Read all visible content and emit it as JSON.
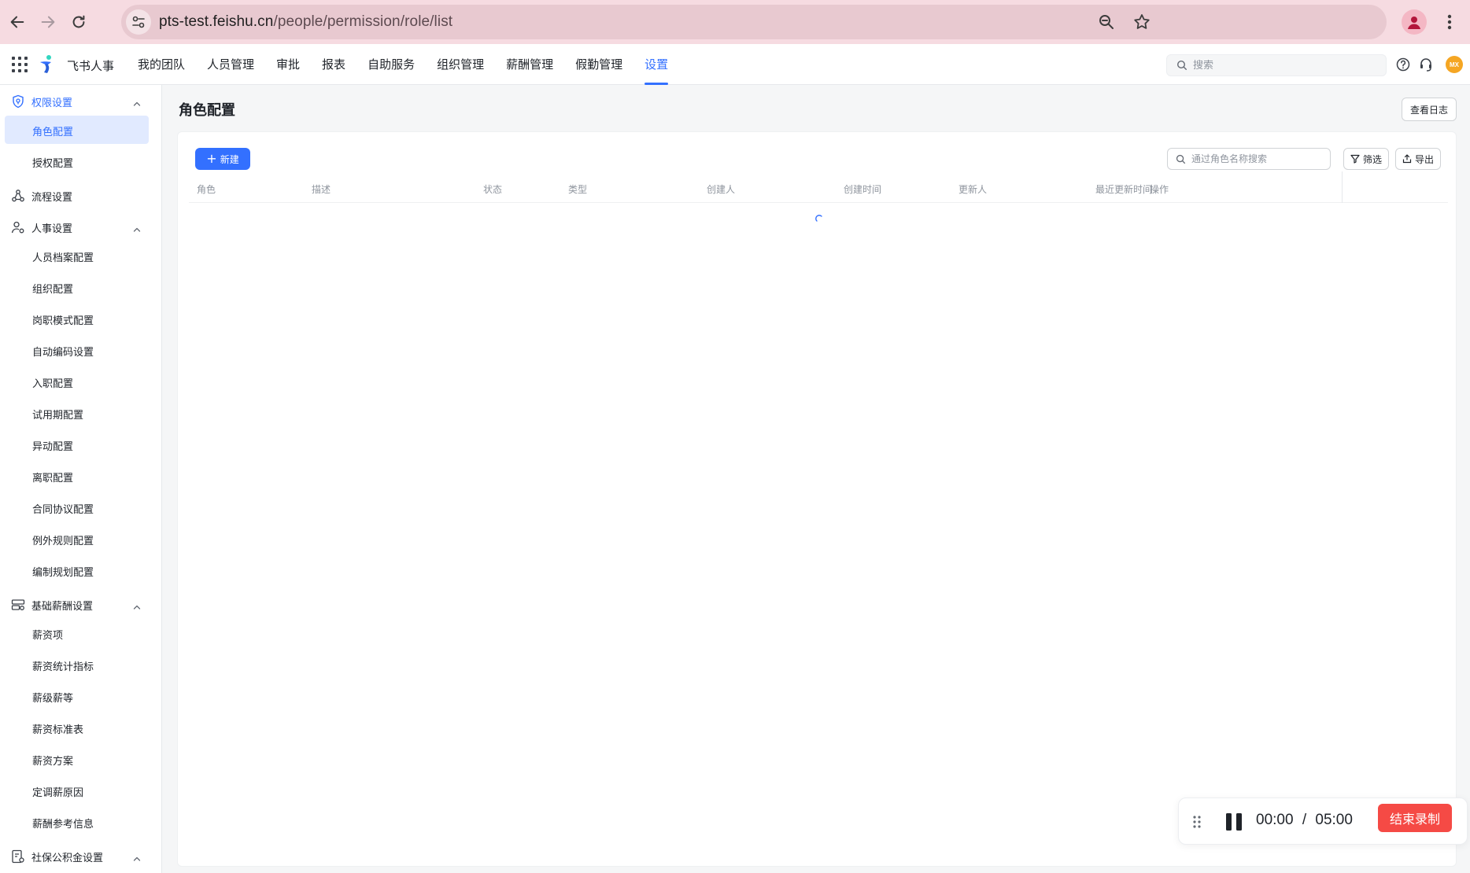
{
  "browser": {
    "url_host": "pts-test.feishu.cn",
    "url_path": "/people/permission/role/list"
  },
  "app": {
    "brand_name": "飞书人事",
    "nav": [
      "我的团队",
      "人员管理",
      "审批",
      "报表",
      "自助服务",
      "组织管理",
      "薪酬管理",
      "假勤管理",
      "设置"
    ],
    "active_nav": "设置",
    "search_placeholder": "搜索",
    "avatar_initials": "MX"
  },
  "sidebar": {
    "groups": [
      {
        "label": "权限设置",
        "icon": "shield-icon",
        "expanded": true,
        "active": true,
        "items": [
          {
            "label": "角色配置",
            "active": true
          },
          {
            "label": "授权配置"
          }
        ]
      },
      {
        "label": "流程设置",
        "icon": "workflow-icon",
        "expanded": false,
        "items": []
      },
      {
        "label": "人事设置",
        "icon": "person-settings-icon",
        "expanded": true,
        "items": [
          {
            "label": "人员档案配置"
          },
          {
            "label": "组织配置"
          },
          {
            "label": "岗职模式配置"
          },
          {
            "label": "自动编码设置"
          },
          {
            "label": "入职配置"
          },
          {
            "label": "试用期配置"
          },
          {
            "label": "异动配置"
          },
          {
            "label": "离职配置"
          },
          {
            "label": "合同协议配置"
          },
          {
            "label": "例外规则配置"
          },
          {
            "label": "编制规划配置"
          }
        ]
      },
      {
        "label": "基础薪酬设置",
        "icon": "salary-icon",
        "expanded": true,
        "items": [
          {
            "label": "薪资项"
          },
          {
            "label": "薪资统计指标"
          },
          {
            "label": "薪级薪等"
          },
          {
            "label": "薪资标准表"
          },
          {
            "label": "薪资方案"
          },
          {
            "label": "定调薪原因"
          },
          {
            "label": "薪酬参考信息"
          }
        ]
      },
      {
        "label": "社保公积金设置",
        "icon": "social-security-icon",
        "expanded": true,
        "items": []
      }
    ]
  },
  "main": {
    "title": "角色配置",
    "log_button": "查看日志",
    "new_button": "新建",
    "search_placeholder": "通过角色名称搜索",
    "filter_button": "筛选",
    "export_button": "导出",
    "columns": [
      "角色",
      "描述",
      "状态",
      "类型",
      "创建人",
      "创建时间",
      "更新人",
      "最近更新时间",
      "操作"
    ]
  },
  "recorder": {
    "elapsed": "00:00",
    "separator": "/",
    "total": "05:00",
    "stop_button": "结束录制"
  },
  "colors": {
    "accent": "#3370ff",
    "browser_bar": "#f6dbe1",
    "stop_red": "#f54a45"
  }
}
